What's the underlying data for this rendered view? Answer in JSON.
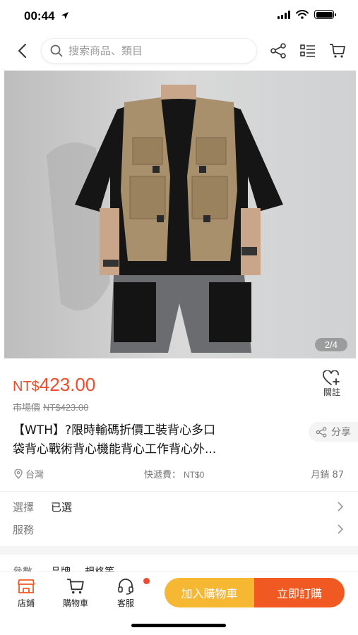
{
  "status_bar": {
    "time": "00:44"
  },
  "nav": {
    "search_placeholder": "搜索商品、類目"
  },
  "product": {
    "image_counter": "2/4",
    "currency": "NT$",
    "price": "423.00",
    "market_price_label": "市場價",
    "market_price": "NT$423.00",
    "follow_label": "關註",
    "title_line1": "【WTH】?限時輸碼折價工裝背心多口",
    "title_line2": "袋背心戰術背心機能背心工作背心外...",
    "share_label": "分享",
    "location": "台灣",
    "shipping_label": "快遞費：",
    "shipping_value": "NT$0",
    "monthly_sales": "月銷 87"
  },
  "options": {
    "select_label": "選擇",
    "select_value": "已選",
    "service_label": "服務",
    "params_label": "參數",
    "params_brand": "品牌",
    "params_spec": "規格等"
  },
  "bottom_bar": {
    "store_label": "店鋪",
    "cart_label": "購物車",
    "service_label": "客服",
    "add_to_cart": "加入購物車",
    "buy_now": "立即訂購"
  },
  "colors": {
    "brand_orange": "#ee4d2d",
    "cart_button": "#f6b733",
    "buy_button": "#f05a22"
  }
}
